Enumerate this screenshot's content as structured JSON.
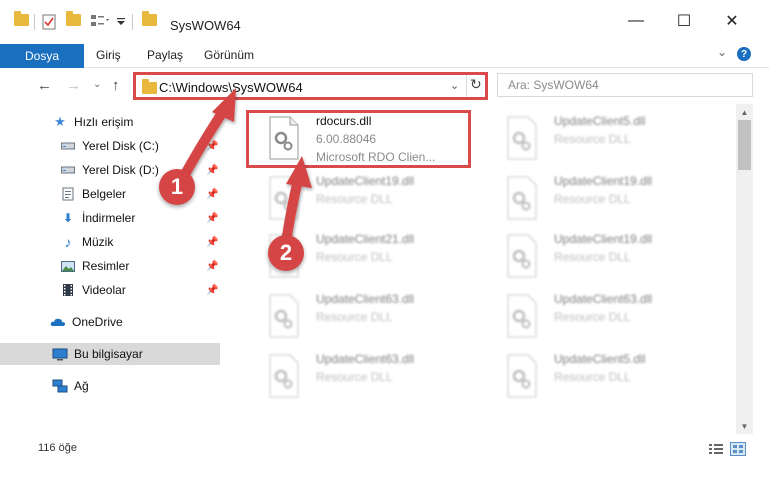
{
  "window": {
    "title": "SysWOW64",
    "minimize": "—",
    "maximize": "☐",
    "close": "✕"
  },
  "ribbon": {
    "tabs": [
      "Dosya",
      "Giriş",
      "Paylaş",
      "Görünüm"
    ],
    "help": "?"
  },
  "address": {
    "path": "C:\\Windows\\SysWOW64",
    "search_placeholder": "Ara: SysWOW64"
  },
  "sidebar": {
    "items": [
      {
        "label": "Hızlı erişim",
        "icon": "star-icon"
      },
      {
        "label": "Yerel Disk (C:)",
        "icon": "drive-icon"
      },
      {
        "label": "Yerel Disk (D:)",
        "icon": "drive-icon"
      },
      {
        "label": "Belgeler",
        "icon": "documents-icon"
      },
      {
        "label": "İndirmeler",
        "icon": "download-icon"
      },
      {
        "label": "Müzik",
        "icon": "music-icon"
      },
      {
        "label": "Resimler",
        "icon": "pictures-icon"
      },
      {
        "label": "Videolar",
        "icon": "videos-icon"
      },
      {
        "label": "OneDrive",
        "icon": "cloud-icon"
      },
      {
        "label": "Bu bilgisayar",
        "icon": "computer-icon"
      },
      {
        "label": "Ağ",
        "icon": "network-icon"
      }
    ]
  },
  "files": [
    {
      "name": "rdocurs.dll",
      "line2": "6.00.88046",
      "line3": "Microsoft RDO Clien..."
    },
    {
      "name": "UpdateClient5.dll",
      "line2": "Resource DLL"
    },
    {
      "name": "UpdateClient19.dll",
      "line2": "Resource DLL"
    },
    {
      "name": "UpdateClient19.dll",
      "line2": "Resource DLL"
    },
    {
      "name": "UpdateClient21.dll",
      "line2": "Resource DLL"
    },
    {
      "name": "UpdateClient19.dll",
      "line2": "Resource DLL"
    },
    {
      "name": "UpdateClient63.dll",
      "line2": "Resource DLL"
    },
    {
      "name": "UpdateClient63.dll",
      "line2": "Resource DLL"
    },
    {
      "name": "UpdateClient63.dll",
      "line2": "Resource DLL"
    },
    {
      "name": "UpdateClient5.dll",
      "line2": "Resource DLL"
    }
  ],
  "status": {
    "count": "116 öğe"
  },
  "annotations": {
    "badge1": "1",
    "badge2": "2"
  },
  "colors": {
    "accent": "#1a6fbf",
    "highlight": "#d94a4a",
    "folder": "#e8b93c"
  }
}
